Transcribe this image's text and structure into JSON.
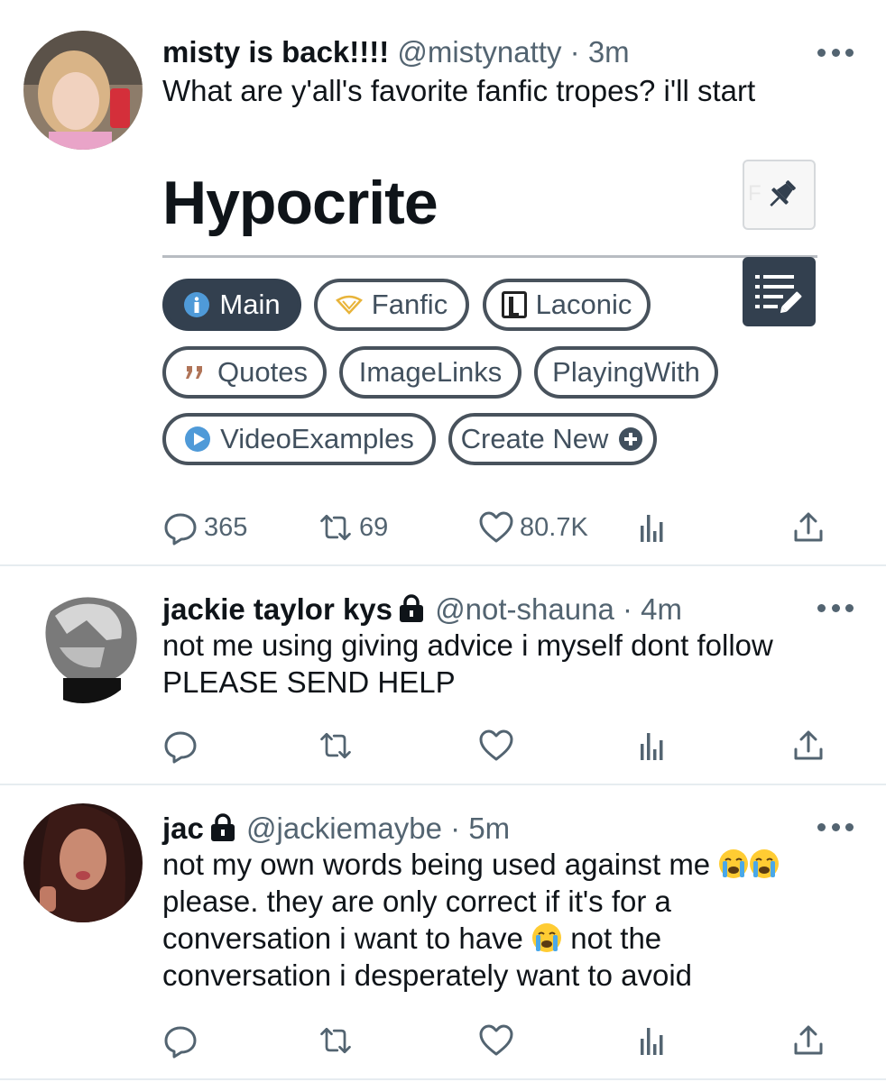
{
  "tweets": [
    {
      "name": "misty is back!!!!",
      "handle": "@mistynatty",
      "sep": "·",
      "time": "3m",
      "text": "What are y'all's favorite fanfic tropes? i'll start",
      "locked": false,
      "counts": {
        "reply": "365",
        "retweet": "69",
        "like": "80.7K"
      }
    },
    {
      "name": "jackie taylor kys",
      "handle": "@not-shauna",
      "sep": "·",
      "time": "4m",
      "text": "not me using giving advice i myself  dont follow\nPLEASE SEND HELP",
      "locked": true,
      "counts": {
        "reply": "",
        "retweet": "",
        "like": ""
      }
    },
    {
      "name": "jac",
      "handle": "@jackiemaybe",
      "sep": "·",
      "time": "5m",
      "text_lines": [
        "not my own words being used against me ",
        "please. they are only correct if it's for a",
        "conversation i want to have ",
        " not the",
        "conversation i desperately want to avoid"
      ],
      "locked": true,
      "counts": {
        "reply": "",
        "retweet": "",
        "like": ""
      }
    }
  ],
  "trope_card": {
    "title": "Hypocrite",
    "faint_label": "F",
    "chips": {
      "main": "Main",
      "fanfic": "Fanfic",
      "laconic": "Laconic",
      "quotes": "Quotes",
      "imagelinks": "ImageLinks",
      "playingwith": "PlayingWith",
      "videoexamples": "VideoExamples",
      "createnew": "Create New"
    }
  },
  "icons": [
    "more-icon",
    "reply-icon",
    "retweet-icon",
    "like-icon",
    "analytics-icon",
    "share-icon",
    "lock-icon",
    "pin-icon",
    "list-edit-icon",
    "info-icon",
    "quote-icon",
    "play-icon",
    "plus-circle-icon",
    "crying-emoji"
  ],
  "colors": {
    "text": "#0f1419",
    "muted": "#536471",
    "chip_border": "#48525c",
    "chip_active": "#33404f",
    "divider": "#e6ecf0"
  }
}
